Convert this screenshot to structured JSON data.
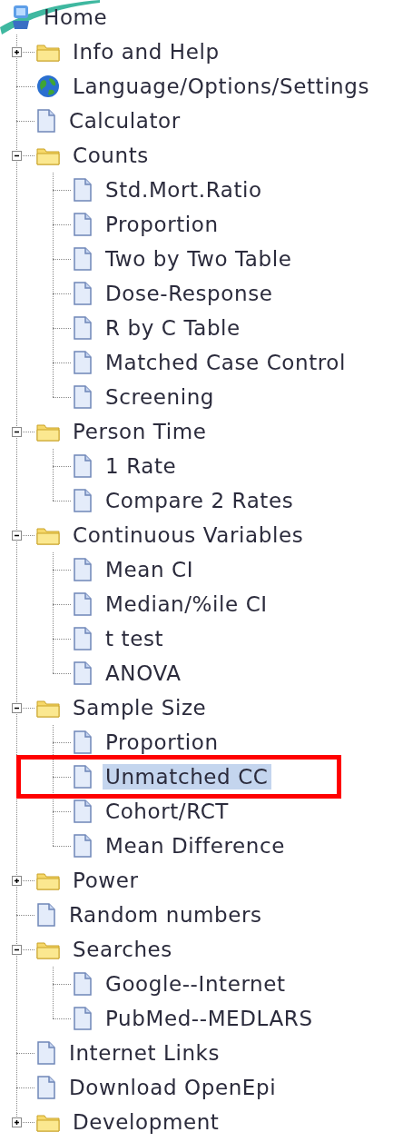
{
  "tree": {
    "items": [
      {
        "kind": "home",
        "label": "Home",
        "selected": false,
        "children": [
          {
            "kind": "folder",
            "label": "Info and Help",
            "expanded": false,
            "selected": false
          },
          {
            "kind": "globe",
            "label": "Language/Options/Settings",
            "selected": false
          },
          {
            "kind": "page",
            "label": "Calculator",
            "selected": false
          },
          {
            "kind": "folder",
            "label": "Counts",
            "expanded": true,
            "selected": false,
            "children": [
              {
                "kind": "page",
                "label": "Std.Mort.Ratio",
                "selected": false
              },
              {
                "kind": "page",
                "label": "Proportion",
                "selected": false
              },
              {
                "kind": "page",
                "label": "Two by Two Table",
                "selected": false
              },
              {
                "kind": "page",
                "label": "Dose-Response",
                "selected": false
              },
              {
                "kind": "page",
                "label": "R by C Table",
                "selected": false
              },
              {
                "kind": "page",
                "label": "Matched Case Control",
                "selected": false
              },
              {
                "kind": "page",
                "label": "Screening",
                "selected": false
              }
            ]
          },
          {
            "kind": "folder",
            "label": "Person Time",
            "expanded": true,
            "selected": false,
            "children": [
              {
                "kind": "page",
                "label": "1 Rate",
                "selected": false
              },
              {
                "kind": "page",
                "label": "Compare 2 Rates",
                "selected": false
              }
            ]
          },
          {
            "kind": "folder",
            "label": "Continuous Variables",
            "expanded": true,
            "selected": false,
            "children": [
              {
                "kind": "page",
                "label": "Mean CI",
                "selected": false
              },
              {
                "kind": "page",
                "label": "Median/%ile CI",
                "selected": false
              },
              {
                "kind": "page",
                "label": "t test",
                "selected": false
              },
              {
                "kind": "page",
                "label": "ANOVA",
                "selected": false
              }
            ]
          },
          {
            "kind": "folder",
            "label": "Sample Size",
            "expanded": true,
            "selected": false,
            "children": [
              {
                "kind": "page",
                "label": "Proportion",
                "selected": false
              },
              {
                "kind": "page",
                "label": "Unmatched CC",
                "selected": true,
                "annotated": true
              },
              {
                "kind": "page",
                "label": "Cohort/RCT",
                "selected": false
              },
              {
                "kind": "page",
                "label": "Mean Difference",
                "selected": false
              }
            ]
          },
          {
            "kind": "folder",
            "label": "Power",
            "expanded": false,
            "selected": false
          },
          {
            "kind": "page",
            "label": "Random numbers",
            "selected": false
          },
          {
            "kind": "folder",
            "label": "Searches",
            "expanded": true,
            "selected": false,
            "children": [
              {
                "kind": "page",
                "label": "Google--Internet",
                "selected": false
              },
              {
                "kind": "page",
                "label": "PubMed--MEDLARS",
                "selected": false
              }
            ]
          },
          {
            "kind": "page",
            "label": "Internet Links",
            "selected": false
          },
          {
            "kind": "page",
            "label": "Download OpenEpi",
            "selected": false
          },
          {
            "kind": "folder",
            "label": "Development",
            "expanded": false,
            "selected": false
          }
        ]
      }
    ]
  }
}
